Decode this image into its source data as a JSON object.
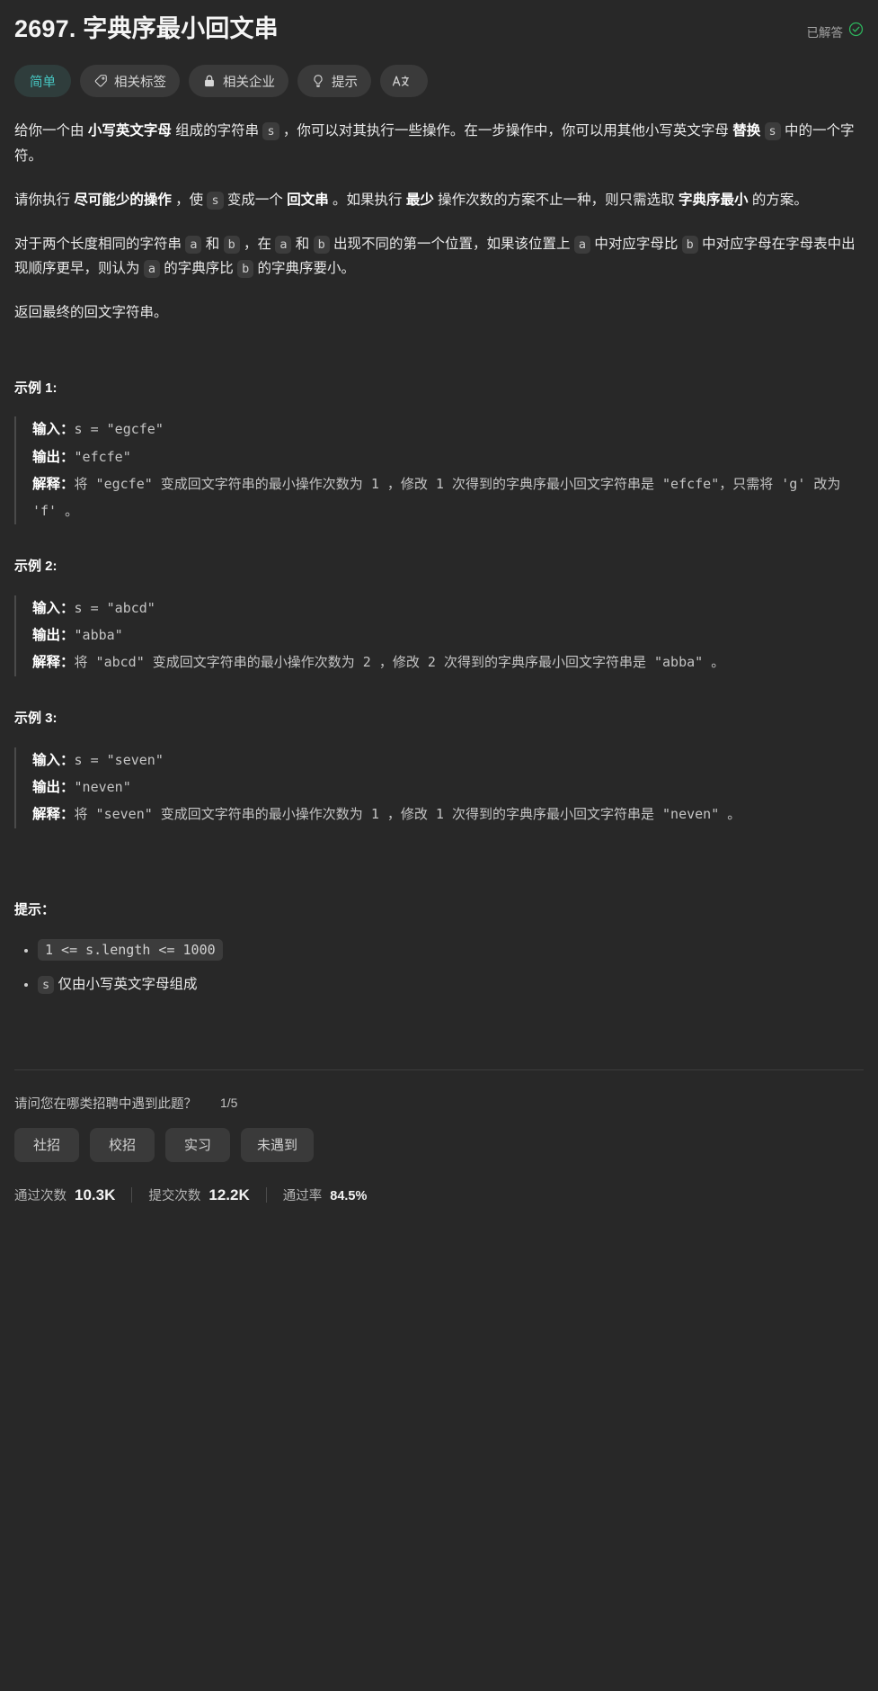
{
  "header": {
    "title": "2697. 字典序最小回文串",
    "solved_label": "已解答",
    "solved_icon": "check-circle-icon",
    "solved_color": "#2db55d"
  },
  "pills": [
    {
      "label": "简单",
      "icon": null,
      "name": "difficulty-badge",
      "accent": "#46c6c2"
    },
    {
      "label": "相关标签",
      "icon": "tag-icon",
      "name": "related-tags-button"
    },
    {
      "label": "相关企业",
      "icon": "lock-icon",
      "name": "related-companies-button"
    },
    {
      "label": "提示",
      "icon": "lightbulb-icon",
      "name": "hints-button"
    },
    {
      "label": "",
      "icon": "translate-icon",
      "name": "translate-button"
    }
  ],
  "description": {
    "p1_a": "给你一个由 ",
    "p1_b": "小写英文字母",
    "p1_c": " 组成的字符串 ",
    "p1_code1": "s",
    "p1_d": " ，你可以对其执行一些操作。在一步操作中，你可以用其他小写英文字母 ",
    "p1_e": "替换",
    "p1_code2": "s",
    "p1_f": " 中的一个字符。",
    "p2_a": "请你执行 ",
    "p2_b": "尽可能少的操作",
    "p2_c": " ，使 ",
    "p2_code1": "s",
    "p2_d": " 变成一个 ",
    "p2_e": "回文串",
    "p2_f": " 。如果执行 ",
    "p2_g": "最少",
    "p2_h": " 操作次数的方案不止一种，则只需选取 ",
    "p2_i": "字典序最小",
    "p2_j": " 的方案。",
    "p3_a": "对于两个长度相同的字符串 ",
    "p3_code_a1": "a",
    "p3_b": " 和 ",
    "p3_code_b1": "b",
    "p3_c": " ，在 ",
    "p3_code_a2": "a",
    "p3_d": " 和 ",
    "p3_code_b2": "b",
    "p3_e": " 出现不同的第一个位置，如果该位置上 ",
    "p3_code_a3": "a",
    "p3_f": " 中对应字母比 ",
    "p3_code_b3": "b",
    "p3_g": " 中对应字母在字母表中出现顺序更早，则认为 ",
    "p3_code_a4": "a",
    "p3_h": " 的字典序比 ",
    "p3_code_b4": "b",
    "p3_i": " 的字典序要小。",
    "p4": "返回最终的回文字符串。"
  },
  "examples": [
    {
      "heading": "示例 1:",
      "input_label": "输入：",
      "input_value": "s = \"egcfe\"",
      "output_label": "输出：",
      "output_value": "\"efcfe\"",
      "explain_label": "解释：",
      "explain_value": "将 \"egcfe\" 变成回文字符串的最小操作次数为 1 ，修改 1 次得到的字典序最小回文字符串是 \"efcfe\"，只需将 'g' 改为 'f' 。"
    },
    {
      "heading": "示例 2:",
      "input_label": "输入：",
      "input_value": "s = \"abcd\"",
      "output_label": "输出：",
      "output_value": "\"abba\"",
      "explain_label": "解释：",
      "explain_value": "将 \"abcd\" 变成回文字符串的最小操作次数为 2 ，修改 2 次得到的字典序最小回文字符串是 \"abba\" 。"
    },
    {
      "heading": "示例 3:",
      "input_label": "输入：",
      "input_value": "s = \"seven\"",
      "output_label": "输出：",
      "output_value": "\"neven\"",
      "explain_label": "解释：",
      "explain_value": "将 \"seven\" 变成回文字符串的最小操作次数为 1 ，修改 1 次得到的字典序最小回文字符串是 \"neven\" 。"
    }
  ],
  "hints": {
    "title": "提示：",
    "item1_code": "1 <= s.length <= 1000",
    "item2_code": "s",
    "item2_text": " 仅由小写英文字母组成"
  },
  "poll": {
    "question": "请问您在哪类招聘中遇到此题？",
    "counter": "1/5",
    "options": [
      "社招",
      "校招",
      "实习",
      "未遇到"
    ]
  },
  "stats": [
    {
      "label": "通过次数",
      "value": "10.3K"
    },
    {
      "label": "提交次数",
      "value": "12.2K"
    },
    {
      "label": "通过率",
      "value": "84.5%"
    }
  ]
}
